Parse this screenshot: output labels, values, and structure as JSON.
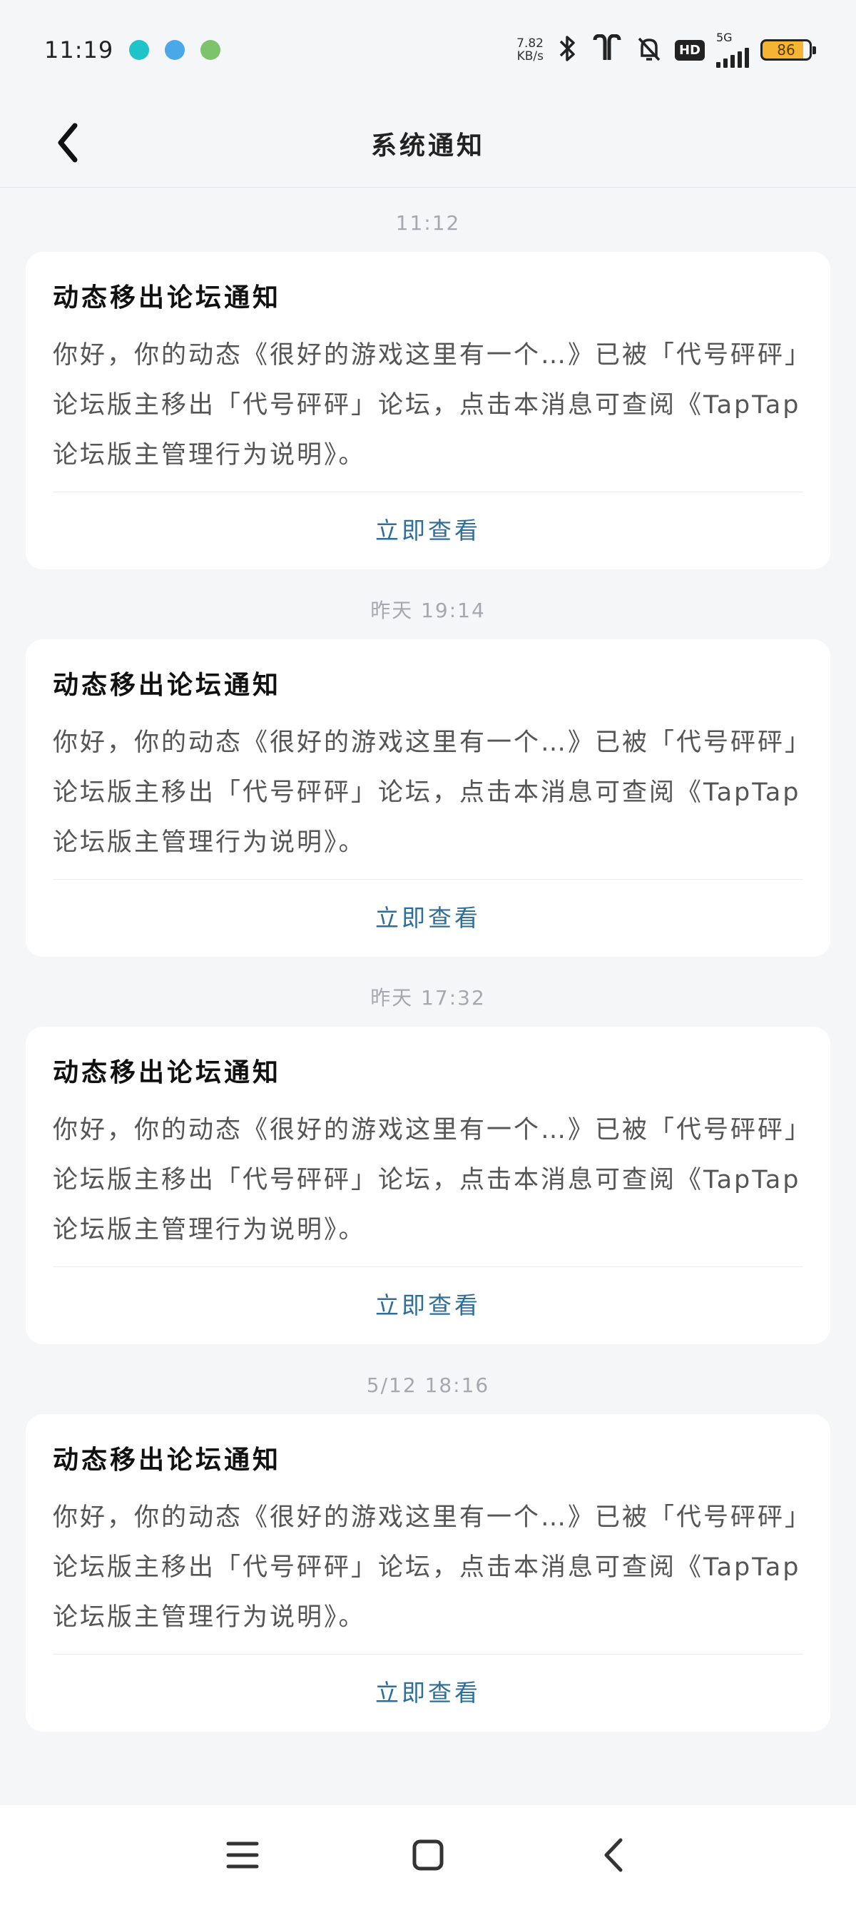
{
  "status_bar": {
    "time": "11:19",
    "net_speed_value": "7.82",
    "net_speed_unit": "KB/s",
    "network_type": "5G",
    "hd_label": "HD",
    "battery_level": "86",
    "icons": [
      "tap-app-icon",
      "browser-app-icon",
      "game-app-icon",
      "bluetooth-icon",
      "earbuds-icon",
      "mute-bell-icon",
      "hd-icon",
      "signal-icon",
      "battery-icon"
    ],
    "accent_colors": {
      "battery": "#f5b533"
    }
  },
  "header": {
    "title": "系统通知",
    "back_icon": "chevron-left-icon"
  },
  "notifications": [
    {
      "timestamp": "11:12",
      "title": "动态移出论坛通知",
      "body": "你好，你的动态《很好的游戏这里有一个…》已被「代号砰砰」论坛版主移出「代号砰砰」论坛，点击本消息可查阅《TapTap论坛版主管理行为说明》。",
      "action": "立即查看"
    },
    {
      "timestamp": "昨天  19:14",
      "title": "动态移出论坛通知",
      "body": "你好，你的动态《很好的游戏这里有一个…》已被「代号砰砰」论坛版主移出「代号砰砰」论坛，点击本消息可查阅《TapTap论坛版主管理行为说明》。",
      "action": "立即查看"
    },
    {
      "timestamp": "昨天  17:32",
      "title": "动态移出论坛通知",
      "body": "你好，你的动态《很好的游戏这里有一个…》已被「代号砰砰」论坛版主移出「代号砰砰」论坛，点击本消息可查阅《TapTap论坛版主管理行为说明》。",
      "action": "立即查看"
    },
    {
      "timestamp": "5/12  18:16",
      "title": "动态移出论坛通知",
      "body": "你好，你的动态《很好的游戏这里有一个…》已被「代号砰砰」论坛版主移出「代号砰砰」论坛，点击本消息可查阅《TapTap论坛版主管理行为说明》。",
      "action": "立即查看"
    }
  ],
  "nav_bar": {
    "icons": [
      "menu-icon",
      "home-icon",
      "back-icon"
    ]
  },
  "colors": {
    "background": "#f5f6f8",
    "card": "#ffffff",
    "action_link": "#2f6e98",
    "timestamp": "#a6a8ad"
  }
}
